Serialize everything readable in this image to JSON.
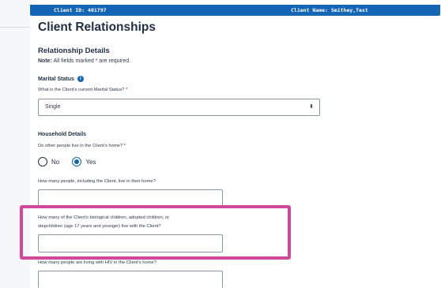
{
  "header": {
    "client_id": "Client ID: 401797",
    "client_name": "Client Name: Smithey,Test"
  },
  "page": {
    "title": "Client Relationships",
    "section_title": "Relationship Details",
    "note_bold": "Note:",
    "note_text": " All fields marked ",
    "note_star": "*",
    "note_end": " are required."
  },
  "marital": {
    "heading": "Marital Status",
    "info_icon": "i",
    "question": "What is the Client's current Marital Status?",
    "required_star": "*",
    "selected": "Single",
    "arrow": "⬍"
  },
  "household": {
    "heading": "Household Details",
    "question": "Do other people live in the Client's home?",
    "required_star": "*",
    "options": [
      "No",
      "Yes"
    ],
    "selected": "Yes",
    "q_people": "How many people, including the Client, live in their home?",
    "q_children_line1": "How many of the Client's biological children, adopted children, or",
    "q_children_line2": "stepchildren (age 17 years and younger) live with the Client?",
    "q_hiv": "How many people are living with HIV in the Client's home?"
  },
  "colors": {
    "header_blue": "#1565b7",
    "highlight_pink": "#d2489c",
    "required_red": "#d0021b"
  }
}
